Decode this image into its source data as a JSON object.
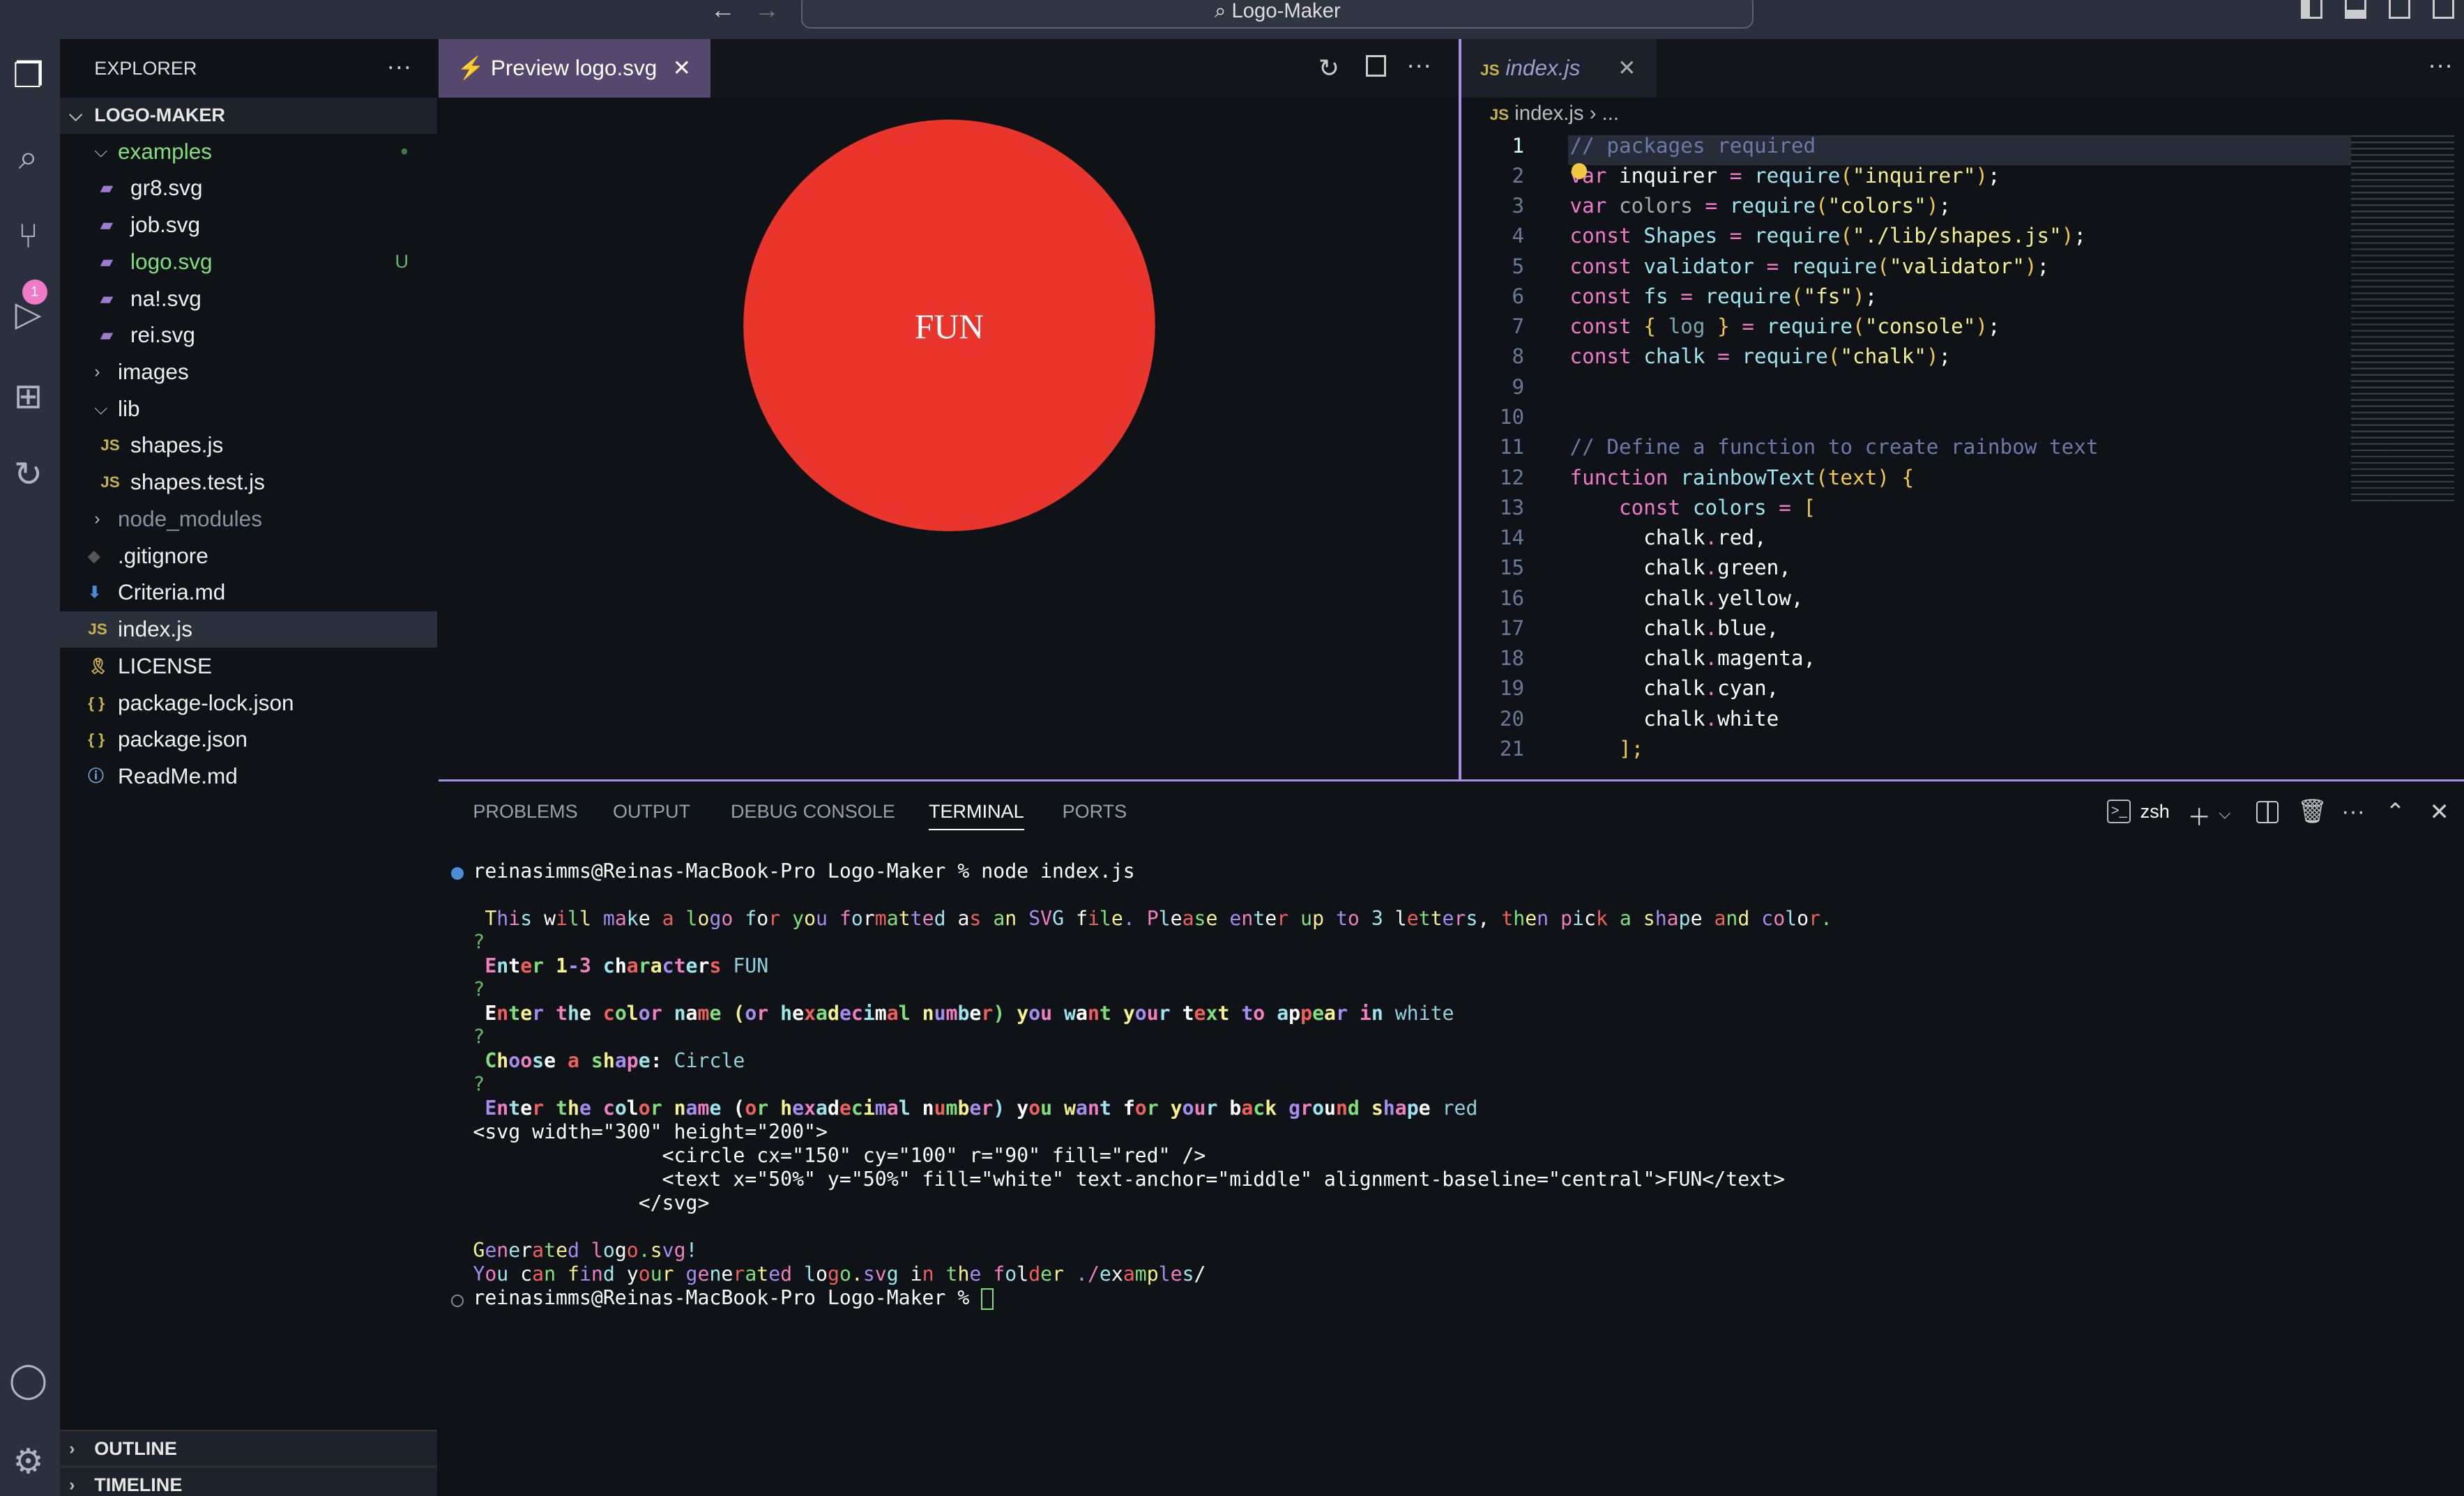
{
  "window": {
    "title": "Logo-Maker"
  },
  "sidebar": {
    "title": "EXPLORER",
    "root": "LOGO-MAKER",
    "items": [
      {
        "label": "examples",
        "type": "folder-open",
        "depth": 1,
        "color": "#7ee07a",
        "status": "dot"
      },
      {
        "label": "gr8.svg",
        "type": "svg",
        "depth": 2
      },
      {
        "label": "job.svg",
        "type": "svg",
        "depth": 2
      },
      {
        "label": "logo.svg",
        "type": "svg",
        "depth": 2,
        "color": "#7ee07a",
        "status": "U"
      },
      {
        "label": "na!.svg",
        "type": "svg",
        "depth": 2
      },
      {
        "label": "rei.svg",
        "type": "svg",
        "depth": 2
      },
      {
        "label": "images",
        "type": "folder",
        "depth": 1
      },
      {
        "label": "lib",
        "type": "folder-open",
        "depth": 1
      },
      {
        "label": "shapes.js",
        "type": "js",
        "depth": 2
      },
      {
        "label": "shapes.test.js",
        "type": "js",
        "depth": 2
      },
      {
        "label": "node_modules",
        "type": "folder",
        "depth": 1,
        "color": "#8a90a0"
      },
      {
        "label": ".gitignore",
        "type": "git",
        "depth": 1
      },
      {
        "label": "Criteria.md",
        "type": "md",
        "depth": 1
      },
      {
        "label": "index.js",
        "type": "js",
        "depth": 1,
        "selected": true
      },
      {
        "label": "LICENSE",
        "type": "license",
        "depth": 1
      },
      {
        "label": "package-lock.json",
        "type": "json",
        "depth": 1
      },
      {
        "label": "package.json",
        "type": "json",
        "depth": 1
      },
      {
        "label": "ReadMe.md",
        "type": "info",
        "depth": 1
      }
    ],
    "outline": "OUTLINE",
    "timeline": "TIMELINE",
    "scm_badge": "1"
  },
  "preview": {
    "tab": "Preview logo.svg",
    "circle_fill": "#e9352b",
    "text": "FUN"
  },
  "editor": {
    "tab": "index.js",
    "breadcrumb": "index.js",
    "breadcrumb_more": "...",
    "lines": [
      [
        [
          "// packages required",
          "cm"
        ]
      ],
      [
        [
          "var",
          "kw"
        ],
        [
          " inquirer ",
          "pl"
        ],
        [
          "=",
          "kw"
        ],
        [
          " ",
          "pl"
        ],
        [
          "require",
          "fn"
        ],
        [
          "(",
          "pu"
        ],
        [
          "\"inquirer\"",
          "str"
        ],
        [
          ")",
          "pu"
        ],
        [
          ";",
          "pl"
        ]
      ],
      [
        [
          "var",
          "kw"
        ],
        [
          " colors ",
          "gr"
        ],
        [
          "=",
          "kw"
        ],
        [
          " ",
          "pl"
        ],
        [
          "require",
          "fn"
        ],
        [
          "(",
          "pu"
        ],
        [
          "\"colors\"",
          "str"
        ],
        [
          ")",
          "pu"
        ],
        [
          ";",
          "pl"
        ]
      ],
      [
        [
          "const",
          "kw"
        ],
        [
          " Shapes ",
          "vr"
        ],
        [
          "=",
          "kw"
        ],
        [
          " ",
          "pl"
        ],
        [
          "require",
          "fn"
        ],
        [
          "(",
          "pu"
        ],
        [
          "\"./lib/shapes.js\"",
          "str"
        ],
        [
          ")",
          "pu"
        ],
        [
          ";",
          "pl"
        ]
      ],
      [
        [
          "const",
          "kw"
        ],
        [
          " validator ",
          "vr"
        ],
        [
          "=",
          "kw"
        ],
        [
          " ",
          "pl"
        ],
        [
          "require",
          "fn"
        ],
        [
          "(",
          "pu"
        ],
        [
          "\"validator\"",
          "str"
        ],
        [
          ")",
          "pu"
        ],
        [
          ";",
          "pl"
        ]
      ],
      [
        [
          "const",
          "kw"
        ],
        [
          " fs ",
          "vr"
        ],
        [
          "=",
          "kw"
        ],
        [
          " ",
          "pl"
        ],
        [
          "require",
          "fn"
        ],
        [
          "(",
          "pu"
        ],
        [
          "\"fs\"",
          "str"
        ],
        [
          ")",
          "pu"
        ],
        [
          ";",
          "pl"
        ]
      ],
      [
        [
          "const",
          "kw"
        ],
        [
          " { ",
          "pu"
        ],
        [
          "log",
          "lg"
        ],
        [
          " } ",
          "pu"
        ],
        [
          "=",
          "kw"
        ],
        [
          " ",
          "pl"
        ],
        [
          "require",
          "fn"
        ],
        [
          "(",
          "pu"
        ],
        [
          "\"console\"",
          "str"
        ],
        [
          ")",
          "pu"
        ],
        [
          ";",
          "pl"
        ]
      ],
      [
        [
          "const",
          "kw"
        ],
        [
          " chalk ",
          "vr"
        ],
        [
          "=",
          "kw"
        ],
        [
          " ",
          "pl"
        ],
        [
          "require",
          "fn"
        ],
        [
          "(",
          "pu"
        ],
        [
          "\"chalk\"",
          "str"
        ],
        [
          ")",
          "pu"
        ],
        [
          ";",
          "pl"
        ]
      ],
      [],
      [],
      [
        [
          "// Define a function to create rainbow text",
          "cm"
        ]
      ],
      [
        [
          "function",
          "kw"
        ],
        [
          " rainbowText",
          "fn"
        ],
        [
          "(",
          "pu"
        ],
        [
          "text",
          "pu"
        ],
        [
          ")",
          "pu"
        ],
        [
          " {",
          "pu"
        ]
      ],
      [
        [
          "    const",
          "kw"
        ],
        [
          " colors ",
          "vr"
        ],
        [
          "=",
          "kw"
        ],
        [
          " [",
          "pu"
        ]
      ],
      [
        [
          "      chalk",
          "pl"
        ],
        [
          ".",
          "kw"
        ],
        [
          "red,",
          "pl"
        ]
      ],
      [
        [
          "      chalk",
          "pl"
        ],
        [
          ".",
          "kw"
        ],
        [
          "green,",
          "pl"
        ]
      ],
      [
        [
          "      chalk",
          "pl"
        ],
        [
          ".",
          "kw"
        ],
        [
          "yellow,",
          "pl"
        ]
      ],
      [
        [
          "      chalk",
          "pl"
        ],
        [
          ".",
          "kw"
        ],
        [
          "blue,",
          "pl"
        ]
      ],
      [
        [
          "      chalk",
          "pl"
        ],
        [
          ".",
          "kw"
        ],
        [
          "magenta,",
          "pl"
        ]
      ],
      [
        [
          "      chalk",
          "pl"
        ],
        [
          ".",
          "kw"
        ],
        [
          "cyan,",
          "pl"
        ]
      ],
      [
        [
          "      chalk",
          "pl"
        ],
        [
          ".",
          "kw"
        ],
        [
          "white",
          "pl"
        ]
      ],
      [
        [
          "    ];",
          "pu"
        ]
      ]
    ]
  },
  "panel": {
    "tabs": [
      "PROBLEMS",
      "OUTPUT",
      "DEBUG CONSOLE",
      "TERMINAL",
      "PORTS"
    ],
    "active": "TERMINAL",
    "shell": "zsh"
  },
  "terminal": {
    "lines": [
      {
        "t": "reinasimms@Reinas-MacBook-Pro Logo-Maker % node index.js",
        "s": "plain"
      },
      {
        "t": "",
        "s": "plain"
      },
      {
        "t": " This will make a logo for you formatted as an SVG file. Please enter up to 3 letters, then pick a shape and color.",
        "s": "rainbow"
      },
      {
        "t": "?",
        "s": "q"
      },
      {
        "t": " Enter 1-3 characters",
        "s": "rainbow",
        "a": " FUN"
      },
      {
        "t": "?",
        "s": "q"
      },
      {
        "t": " Enter the color name (or hexadecimal number) you want your text to appear in",
        "s": "rainbow",
        "a": " white"
      },
      {
        "t": "?",
        "s": "q"
      },
      {
        "t": " Choose a shape:",
        "s": "rainbow",
        "a": " Circle"
      },
      {
        "t": "?",
        "s": "q"
      },
      {
        "t": " Enter the color name (or hexadecimal number) you want for your back ground shape",
        "s": "rainbow",
        "a": " red"
      },
      {
        "t": "<svg width=\"300\" height=\"200\">",
        "s": "plain"
      },
      {
        "t": "                <circle cx=\"150\" cy=\"100\" r=\"90\" fill=\"red\" />",
        "s": "plain"
      },
      {
        "t": "                <text x=\"50%\" y=\"50%\" fill=\"white\" text-anchor=\"middle\" alignment-baseline=\"central\">FUN</text>",
        "s": "plain"
      },
      {
        "t": "              </svg>",
        "s": "plain"
      },
      {
        "t": "",
        "s": "plain"
      },
      {
        "t": "Generated logo.svg!",
        "s": "rainbow2"
      },
      {
        "t": "You can find your generated logo.svg in the folder ./examples/",
        "s": "rainbow2"
      },
      {
        "t": "reinasimms@Reinas-MacBook-Pro Logo-Maker % ",
        "s": "prompt"
      }
    ]
  },
  "colors": {
    "accent": "#a98ee6",
    "tab_active": "#56476f",
    "rainbow": [
      "#f0605a",
      "#7ee07a",
      "#f5f08a",
      "#a48cf0",
      "#f07ec0",
      "#9ae6f0",
      "#ffffff"
    ]
  }
}
